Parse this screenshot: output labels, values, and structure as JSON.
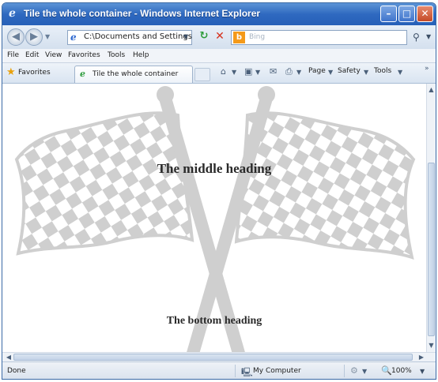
{
  "window": {
    "title": "Tile the whole container - Windows Internet Explorer",
    "minimize_glyph": "–",
    "maximize_glyph": "□",
    "close_glyph": "✕"
  },
  "address_bar": {
    "url": "C:\\Documents and Settings",
    "search_placeholder": "Bing"
  },
  "menu": [
    "File",
    "Edit",
    "View",
    "Favorites",
    "Tools",
    "Help"
  ],
  "favorites_bar": {
    "favorites_label": "Favorites",
    "tab_label": "Tile the whole container",
    "commands": [
      "Page",
      "Safety",
      "Tools"
    ]
  },
  "page": {
    "middle_heading": "The middle heading",
    "bottom_heading": "The bottom heading",
    "background_image": "checkered-flags"
  },
  "status_bar": {
    "status_text": "Done",
    "zone": "My Computer",
    "zoom": "100%"
  },
  "colors": {
    "title_bar": "#2f69c0",
    "close_button": "#c44a27",
    "flag_gray": "#cfcfcf"
  },
  "icons": {
    "browser": "ie-logo-icon",
    "back": "back-arrow-icon",
    "forward": "forward-arrow-icon",
    "refresh": "refresh-icon",
    "stop": "stop-icon",
    "search": "search-icon",
    "favorites": "star-icon",
    "home": "home-icon",
    "feeds": "feeds-icon",
    "mail": "mail-icon",
    "print": "print-icon",
    "zone": "computer-icon",
    "zoom": "zoom-icon"
  }
}
